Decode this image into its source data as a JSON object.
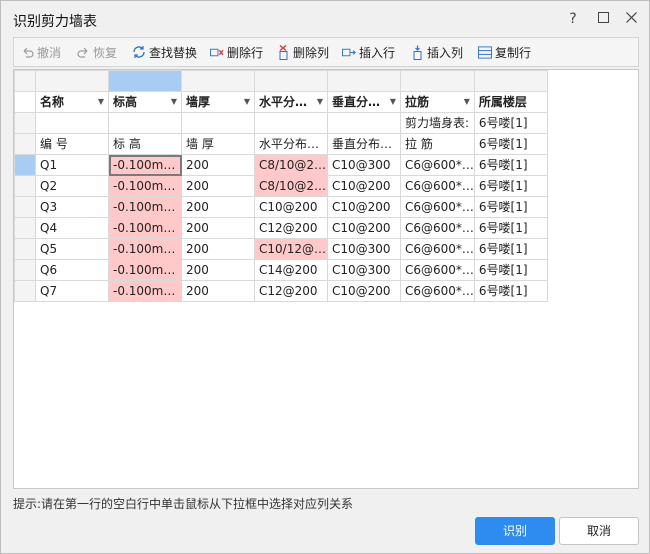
{
  "window": {
    "title": "识别剪力墙表"
  },
  "toolbar": {
    "undo": "撤消",
    "redo": "恢复",
    "find_replace": "查找替换",
    "delete_row": "删除行",
    "delete_col": "删除列",
    "insert_row": "插入行",
    "insert_col": "插入列",
    "copy_row": "复制行"
  },
  "table": {
    "headers": [
      "名称",
      "标高",
      "墙厚",
      "水平分…",
      "垂直分…",
      "拉筋",
      "所属楼层"
    ],
    "rows": [
      [
        "",
        "",
        "",
        "",
        "",
        "剪力墙身表:",
        "6号喽[1]"
      ],
      [
        "编  号",
        "标  高",
        "墙  厚",
        "水平分布…",
        "垂直分布…",
        "拉  筋",
        "6号喽[1]"
      ],
      [
        "Q1",
        "-0.100m…",
        "200",
        "C8/10@2…",
        "C10@300",
        "C6@600*…",
        "6号喽[1]"
      ],
      [
        "Q2",
        "-0.100m…",
        "200",
        "C8/10@2…",
        "C10@200",
        "C6@600*…",
        "6号喽[1]"
      ],
      [
        "Q3",
        "-0.100m…",
        "200",
        "C10@200",
        "C10@200",
        "C6@600*…",
        "6号喽[1]"
      ],
      [
        "Q4",
        "-0.100m…",
        "200",
        "C12@200",
        "C10@200",
        "C6@600*…",
        "6号喽[1]"
      ],
      [
        "Q5",
        "-0.100m…",
        "200",
        "C10/12@…",
        "C10@300",
        "C6@600*…",
        "6号喽[1]"
      ],
      [
        "Q6",
        "-0.100m…",
        "200",
        "C14@200",
        "C10@300",
        "C6@600*…",
        "6号喽[1]"
      ],
      [
        "Q7",
        "-0.100m…",
        "200",
        "C12@200",
        "C10@200",
        "C6@600*…",
        "6号喽[1]"
      ]
    ]
  },
  "hint": "提示:请在第一行的空白行中单击鼠标从下拉框中选择对应列关系",
  "buttons": {
    "ok": "识别",
    "cancel": "取消"
  },
  "colors": {
    "accent": "#2e8cf0",
    "error_cell": "#ffc9c9",
    "selected_col": "#a9cdf2"
  }
}
